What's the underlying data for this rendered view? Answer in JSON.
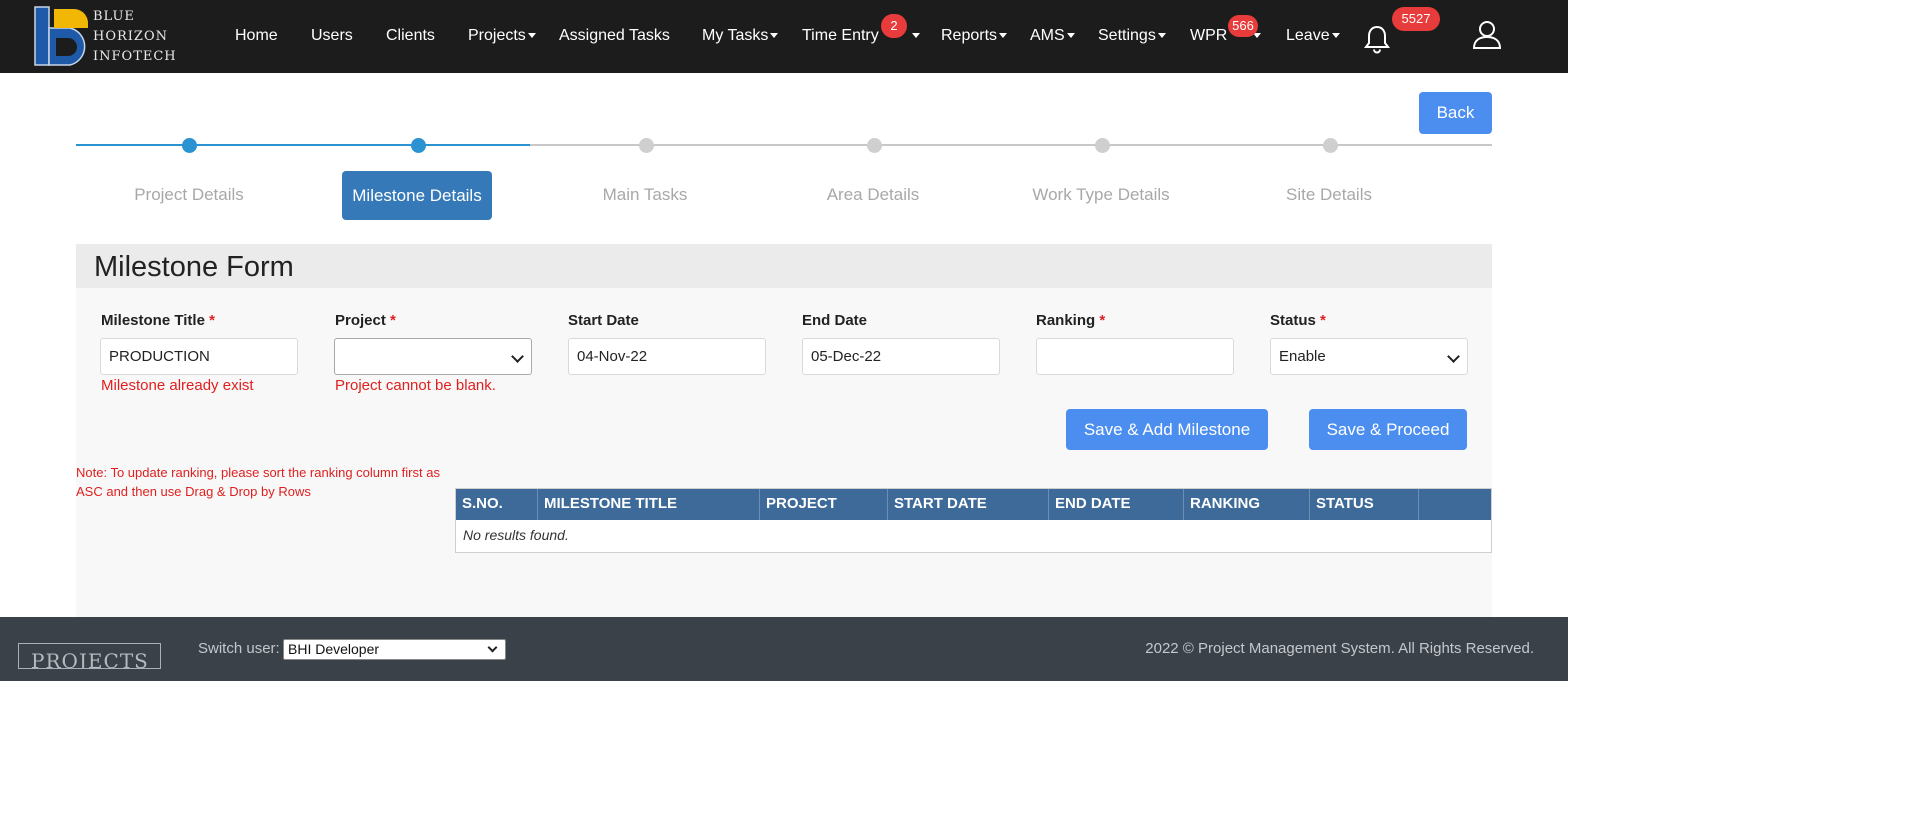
{
  "brand": {
    "line1": "BLUE",
    "line2": "HORIZON",
    "line3": "INFOTECH",
    "colors": {
      "blue": "#1e5aa8",
      "gold": "#f2b705",
      "navbar": "#1c1c1c"
    }
  },
  "nav": {
    "home": "Home",
    "users": "Users",
    "clients": "Clients",
    "projects": "Projects",
    "assigned_tasks": "Assigned Tasks",
    "my_tasks": "My Tasks",
    "time_entry": "Time Entry",
    "time_entry_badge": "2",
    "reports": "Reports",
    "ams": "AMS",
    "settings": "Settings",
    "wpr": "WPR",
    "wpr_badge": "566",
    "leave": "Leave",
    "notifications_badge": "5527",
    "icons": [
      "bell-icon",
      "user-icon",
      "chevron-down-icon"
    ]
  },
  "back_label": "Back",
  "steps": [
    {
      "label": "Project Details",
      "state": "done"
    },
    {
      "label": "Milestone Details",
      "state": "active"
    },
    {
      "label": "Main Tasks",
      "state": "pending"
    },
    {
      "label": "Area Details",
      "state": "pending"
    },
    {
      "label": "Work Type Details",
      "state": "pending"
    },
    {
      "label": "Site Details",
      "state": "pending"
    }
  ],
  "form": {
    "title": "Milestone Form",
    "required_marker": "*",
    "milestone_title": {
      "label": "Milestone Title",
      "value": "PRODUCTION",
      "error": "Milestone already exist"
    },
    "project": {
      "label": "Project",
      "value": "",
      "error": "Project cannot be blank."
    },
    "start_date": {
      "label": "Start Date",
      "value": "04-Nov-22"
    },
    "end_date": {
      "label": "End Date",
      "value": "05-Dec-22"
    },
    "ranking": {
      "label": "Ranking",
      "value": ""
    },
    "status": {
      "label": "Status",
      "value": "Enable"
    },
    "save_add_label": "Save & Add Milestone",
    "save_proceed_label": "Save & Proceed"
  },
  "note": "Note: To update ranking, please sort the ranking column first as ASC and then use Drag & Drop by Rows",
  "table": {
    "columns": [
      "S.NO.",
      "MILESTONE TITLE",
      "PROJECT",
      "START DATE",
      "END DATE",
      "RANKING",
      "STATUS",
      ""
    ],
    "empty_text": "No results found."
  },
  "footer": {
    "logo_text": "PROJECTS",
    "switch_label": "Switch user:",
    "switch_value": "BHI Developer",
    "copyright": "2022 © Project Management System. All Rights Reserved."
  },
  "colors": {
    "primary_button": "#4b8ef0",
    "active_step": "#3579b8",
    "table_header": "#3d6a98",
    "error": "#e02020",
    "badge": "#e83b3b"
  }
}
